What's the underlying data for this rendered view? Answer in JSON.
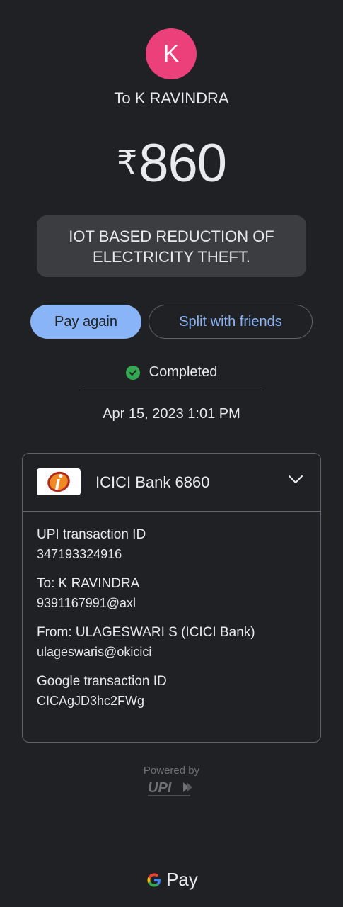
{
  "recipient": {
    "initial": "K",
    "label": "To K RAVINDRA",
    "avatar_color": "#ec407a"
  },
  "amount": {
    "currency": "₹",
    "value": "860"
  },
  "note": "IOT BASED REDUCTION OF ELECTRICITY THEFT.",
  "actions": {
    "pay_again": "Pay again",
    "split": "Split with friends"
  },
  "status": {
    "icon": "check-circle-icon",
    "text": "Completed",
    "color": "#34a853"
  },
  "datetime": "Apr 15, 2023 1:01 PM",
  "account": {
    "bank_logo": "icici-logo",
    "name": "ICICI Bank 6860",
    "expand_icon": "chevron-down-icon"
  },
  "details": [
    {
      "label": "UPI transaction ID",
      "value": "347193324916"
    },
    {
      "label": "To: K RAVINDRA",
      "value": "9391167991@axl"
    },
    {
      "label": "From: ULAGESWARI S (ICICI Bank)",
      "value": "ulageswaris@okicici"
    },
    {
      "label": "Google transaction ID",
      "value": "CICAgJD3hc2FWg"
    }
  ],
  "footer": {
    "powered_by": "Powered by",
    "upi_logo": "upi-logo",
    "brand_pay": "Pay"
  },
  "colors": {
    "background": "#202124",
    "accent": "#8ab4f8",
    "surface": "#3c3d40"
  }
}
